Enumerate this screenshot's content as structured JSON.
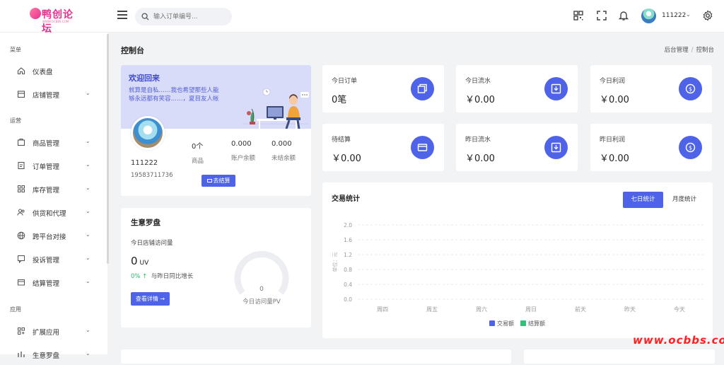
{
  "header": {
    "logo_text": "鸭创论坛",
    "logo_sub": "WWW.OCBBS.COM",
    "search_placeholder": "输入订单编号...",
    "user_name": "111222",
    "user_caret": "⌄"
  },
  "sidebar": {
    "group_menu": "菜单",
    "group_ops": "运营",
    "group_app": "应用",
    "items": [
      {
        "label": "仪表盘",
        "icon": "home-icon"
      },
      {
        "label": "店铺管理",
        "icon": "store-icon"
      },
      {
        "label": "商品管理",
        "icon": "goods-icon"
      },
      {
        "label": "订单管理",
        "icon": "order-icon"
      },
      {
        "label": "库存管理",
        "icon": "inventory-icon"
      },
      {
        "label": "供货和代理",
        "icon": "supply-icon"
      },
      {
        "label": "跨平台对接",
        "icon": "globe-icon"
      },
      {
        "label": "投诉管理",
        "icon": "complaint-icon"
      },
      {
        "label": "结算管理",
        "icon": "settlement-icon"
      },
      {
        "label": "扩展应用",
        "icon": "apps-icon"
      },
      {
        "label": "生意罗盘",
        "icon": "compass-icon"
      }
    ]
  },
  "page": {
    "title": "控制台",
    "crumb_1": "后台管理",
    "crumb_sep": "/",
    "crumb_2": "控制台"
  },
  "welcome": {
    "title": "欢迎回来",
    "message": "就算是自私……我也希望那些人能够永远都有笑容……，夏目友人帐",
    "username": "111222",
    "phone": "19583711736",
    "stats": [
      {
        "value": "0个",
        "label": "商品"
      },
      {
        "value": "0.000",
        "label": "账户余额"
      },
      {
        "value": "0.000",
        "label": "未结余额"
      }
    ],
    "button": "去结算"
  },
  "mini_cards": [
    {
      "label": "今日订单",
      "value": "0笔",
      "icon": "copy-icon"
    },
    {
      "label": "今日流水",
      "value": "￥0.00",
      "icon": "inbox-icon"
    },
    {
      "label": "今日利润",
      "value": "￥0.00",
      "icon": "dollar-icon"
    },
    {
      "label": "待结算",
      "value": "￥0.00",
      "icon": "card-icon"
    },
    {
      "label": "昨日流水",
      "value": "￥0.00",
      "icon": "inbox-icon"
    },
    {
      "label": "昨日利润",
      "value": "￥0.00",
      "icon": "dollar-icon"
    }
  ],
  "compass": {
    "title": "生意罗盘",
    "visits_label": "今日店铺访问量",
    "visits_value": "0",
    "visits_unit": "UV",
    "growth_pct": "0% ↑",
    "growth_text": "与昨日同比增长",
    "button": "查看详情 →",
    "gauge_value": "0",
    "gauge_label": "今日访问量PV"
  },
  "trade": {
    "title": "交易统计",
    "tab_active": "七日统计",
    "tab_other": "月度统计"
  },
  "chart_data": {
    "type": "bar",
    "ylabel": "单位：元",
    "categories": [
      "周四",
      "周五",
      "周六",
      "周日",
      "前天",
      "昨天",
      "今天"
    ],
    "y_ticks": [
      "0.0",
      "0.4",
      "0.8",
      "1.2",
      "1.6",
      "2.0"
    ],
    "ylim": [
      0,
      2.0
    ],
    "grid": true,
    "legend_position": "bottom",
    "series": [
      {
        "name": "交易额",
        "color": "#4f63e8",
        "values": [
          0,
          0,
          0,
          0,
          0,
          0,
          0
        ]
      },
      {
        "name": "结算额",
        "color": "#2fc27a",
        "values": [
          0,
          0,
          0,
          0,
          0,
          0,
          0
        ]
      }
    ]
  },
  "watermark": "www.ocbbs.com"
}
